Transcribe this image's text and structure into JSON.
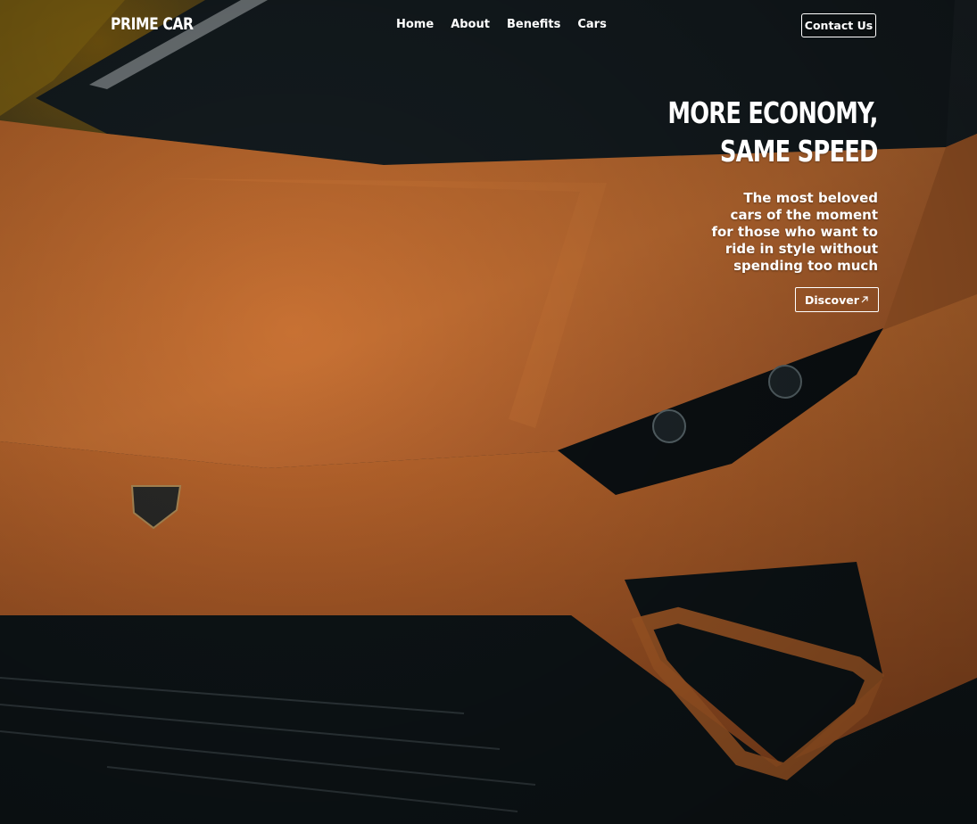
{
  "brand": {
    "name": "PRIME CAR"
  },
  "nav": {
    "items": [
      {
        "label": "Home"
      },
      {
        "label": "About"
      },
      {
        "label": "Benefits"
      },
      {
        "label": "Cars"
      }
    ],
    "contact_label": "Contact Us"
  },
  "hero": {
    "headline_line1": "MORE ECONOMY,",
    "headline_line2": "SAME SPEED",
    "subtext": "The most beloved cars of the moment for those who want to ride in style without spending too much",
    "cta_label": "Discover",
    "cta_icon": "arrow-up-right-icon"
  },
  "colors": {
    "car_body": "#c8702f",
    "background": "#0e1518",
    "text": "#ffffff"
  }
}
